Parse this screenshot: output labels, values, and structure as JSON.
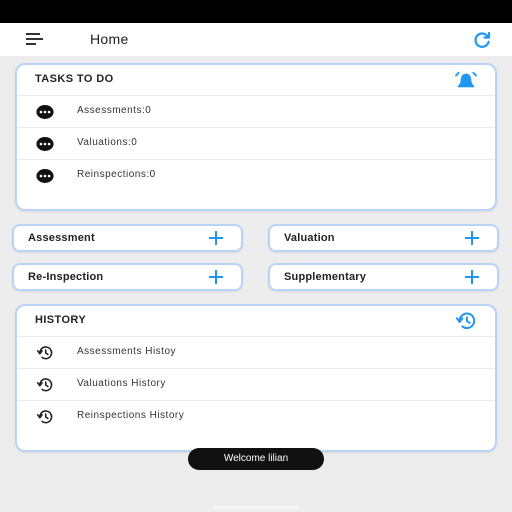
{
  "app": {
    "title": "Home"
  },
  "icons": {
    "menu": "menu-icon",
    "refresh": "refresh-icon",
    "alarm": "alarm-icon",
    "more": "more-horizontal-icon",
    "history": "history-icon",
    "plus": "plus-icon"
  },
  "colors": {
    "accent": "#2196f3",
    "card_border": "#b9d4f7",
    "background": "#ededed",
    "toast_bg": "#111111"
  },
  "tasks": {
    "title": "TASKS TO DO",
    "items": [
      {
        "label": "Assessments:0"
      },
      {
        "label": "Valuations:0"
      },
      {
        "label": "Reinspections:0"
      }
    ]
  },
  "actions": {
    "assessment": "Assessment",
    "valuation": "Valuation",
    "reinspection": "Re-Inspection",
    "supplementary": "Supplementary"
  },
  "history": {
    "title": "HISTORY",
    "items": [
      {
        "label": "Assessments Histoy"
      },
      {
        "label": "Valuations History"
      },
      {
        "label": "Reinspections History"
      }
    ]
  },
  "toast": {
    "message": "Welcome lilian"
  }
}
